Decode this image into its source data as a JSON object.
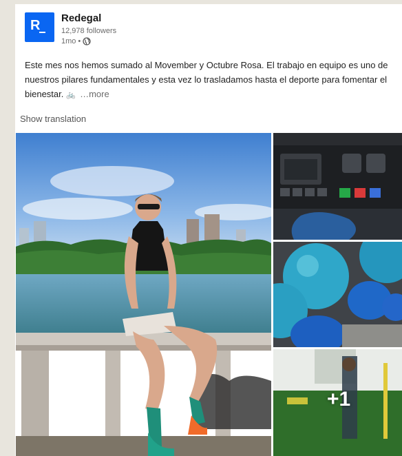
{
  "company": {
    "name": "Redegal",
    "logo_letter": "R",
    "followers": "12,978 followers",
    "time": "1mo",
    "separator": "•"
  },
  "post": {
    "text": "Este mes nos hemos sumado al Movember y Octubre Rosa. El trabajo en equipo es uno de nuestros pilares fundamentales y esta vez lo trasladamos hasta el deporte para fomentar el bienestar.",
    "emoji": "🚲",
    "more_label": "…more"
  },
  "show_translation": "Show translation",
  "photos": {
    "extra_count": "+1"
  },
  "colors": {
    "brand": "#0a66f2"
  },
  "icons": [
    "globe-icon",
    "bike-emoji-icon"
  ]
}
